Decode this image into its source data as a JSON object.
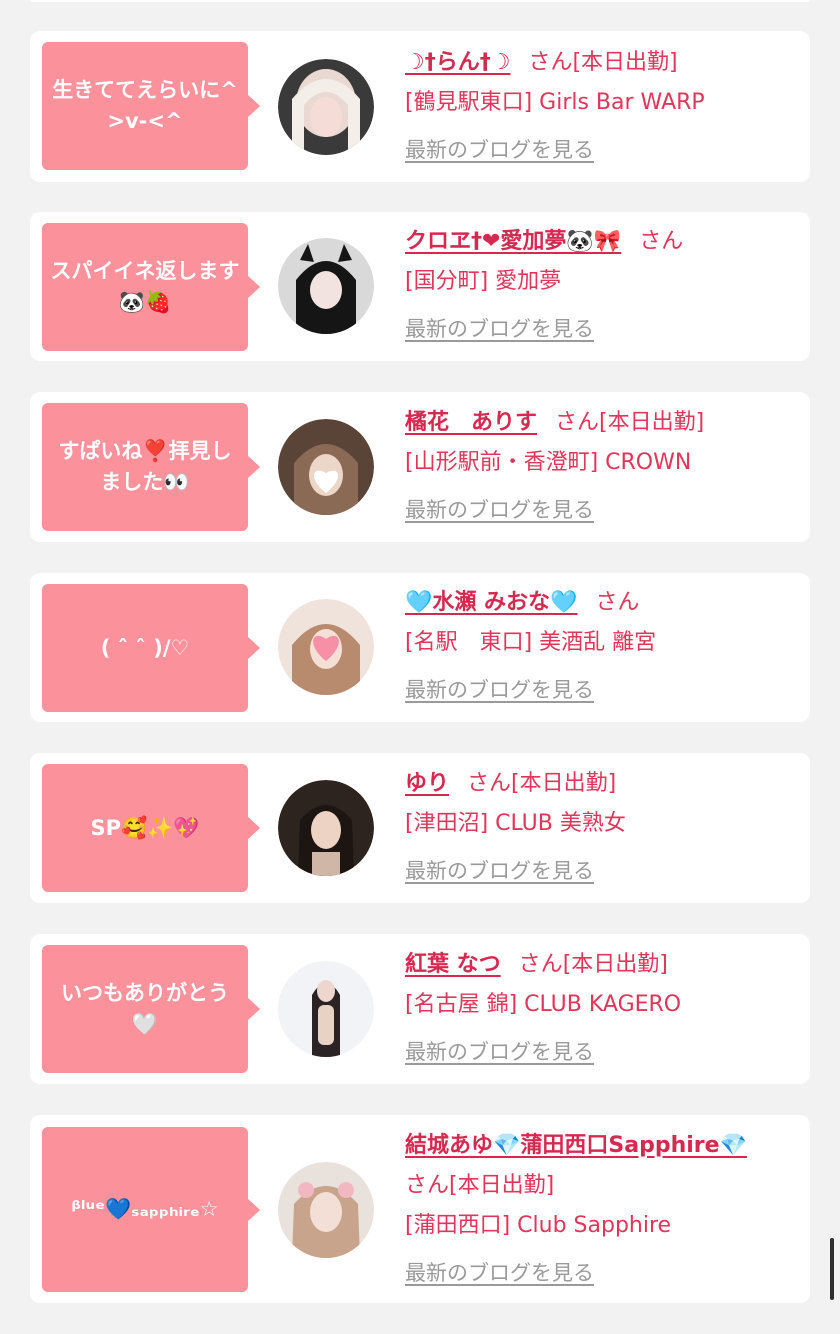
{
  "common": {
    "san_label": "さん",
    "blog_link_label": "最新のブログを見る"
  },
  "colors": {
    "background": "#f2f2f2",
    "card": "#ffffff",
    "bubble": "#fb919b",
    "name": "#d6294f",
    "text_accent": "#e0365a",
    "link_gray": "#9a9a9a"
  },
  "entries": [
    {
      "message": "生きててえらいに^>v-<^",
      "name": "☽†らん†☽",
      "status": "[本日出勤]",
      "shop": "[鶴見駅東口] Girls Bar WARP"
    },
    {
      "message": "スパイイネ返します🐼🍓",
      "name": "クロヱ†❤愛加夢🐼🎀",
      "status": "",
      "shop": "[国分町] 愛加夢"
    },
    {
      "message": "すぱいね❣️拝見しました👀",
      "name": "橘花　ありす",
      "status": "[本日出勤]",
      "shop": "[山形駅前・香澄町] CROWN"
    },
    {
      "message": "( ˆ ˆ )/♡",
      "name": "🩵水瀬 みおな🩵",
      "status": "",
      "shop": "[名駅　東口] 美酒乱 離宮"
    },
    {
      "message": "SP🥰✨💖",
      "name": "ゆり",
      "status": "[本日出勤]",
      "shop": "[津田沼] CLUB 美熟女"
    },
    {
      "message": "いつもありがとう🤍",
      "name": "紅葉 なつ",
      "status": "[本日出勤]",
      "shop": "[名古屋 錦] CLUB KAGERO"
    },
    {
      "message": "ᵝˡᵘᵉ💙ₛₐₚₚₕᵢᵣₑ☆",
      "name": "結城あゆ💎蒲田西口Sapphire💎",
      "status": "[本日出勤]",
      "shop": "[蒲田西口] Club Sapphire"
    }
  ]
}
